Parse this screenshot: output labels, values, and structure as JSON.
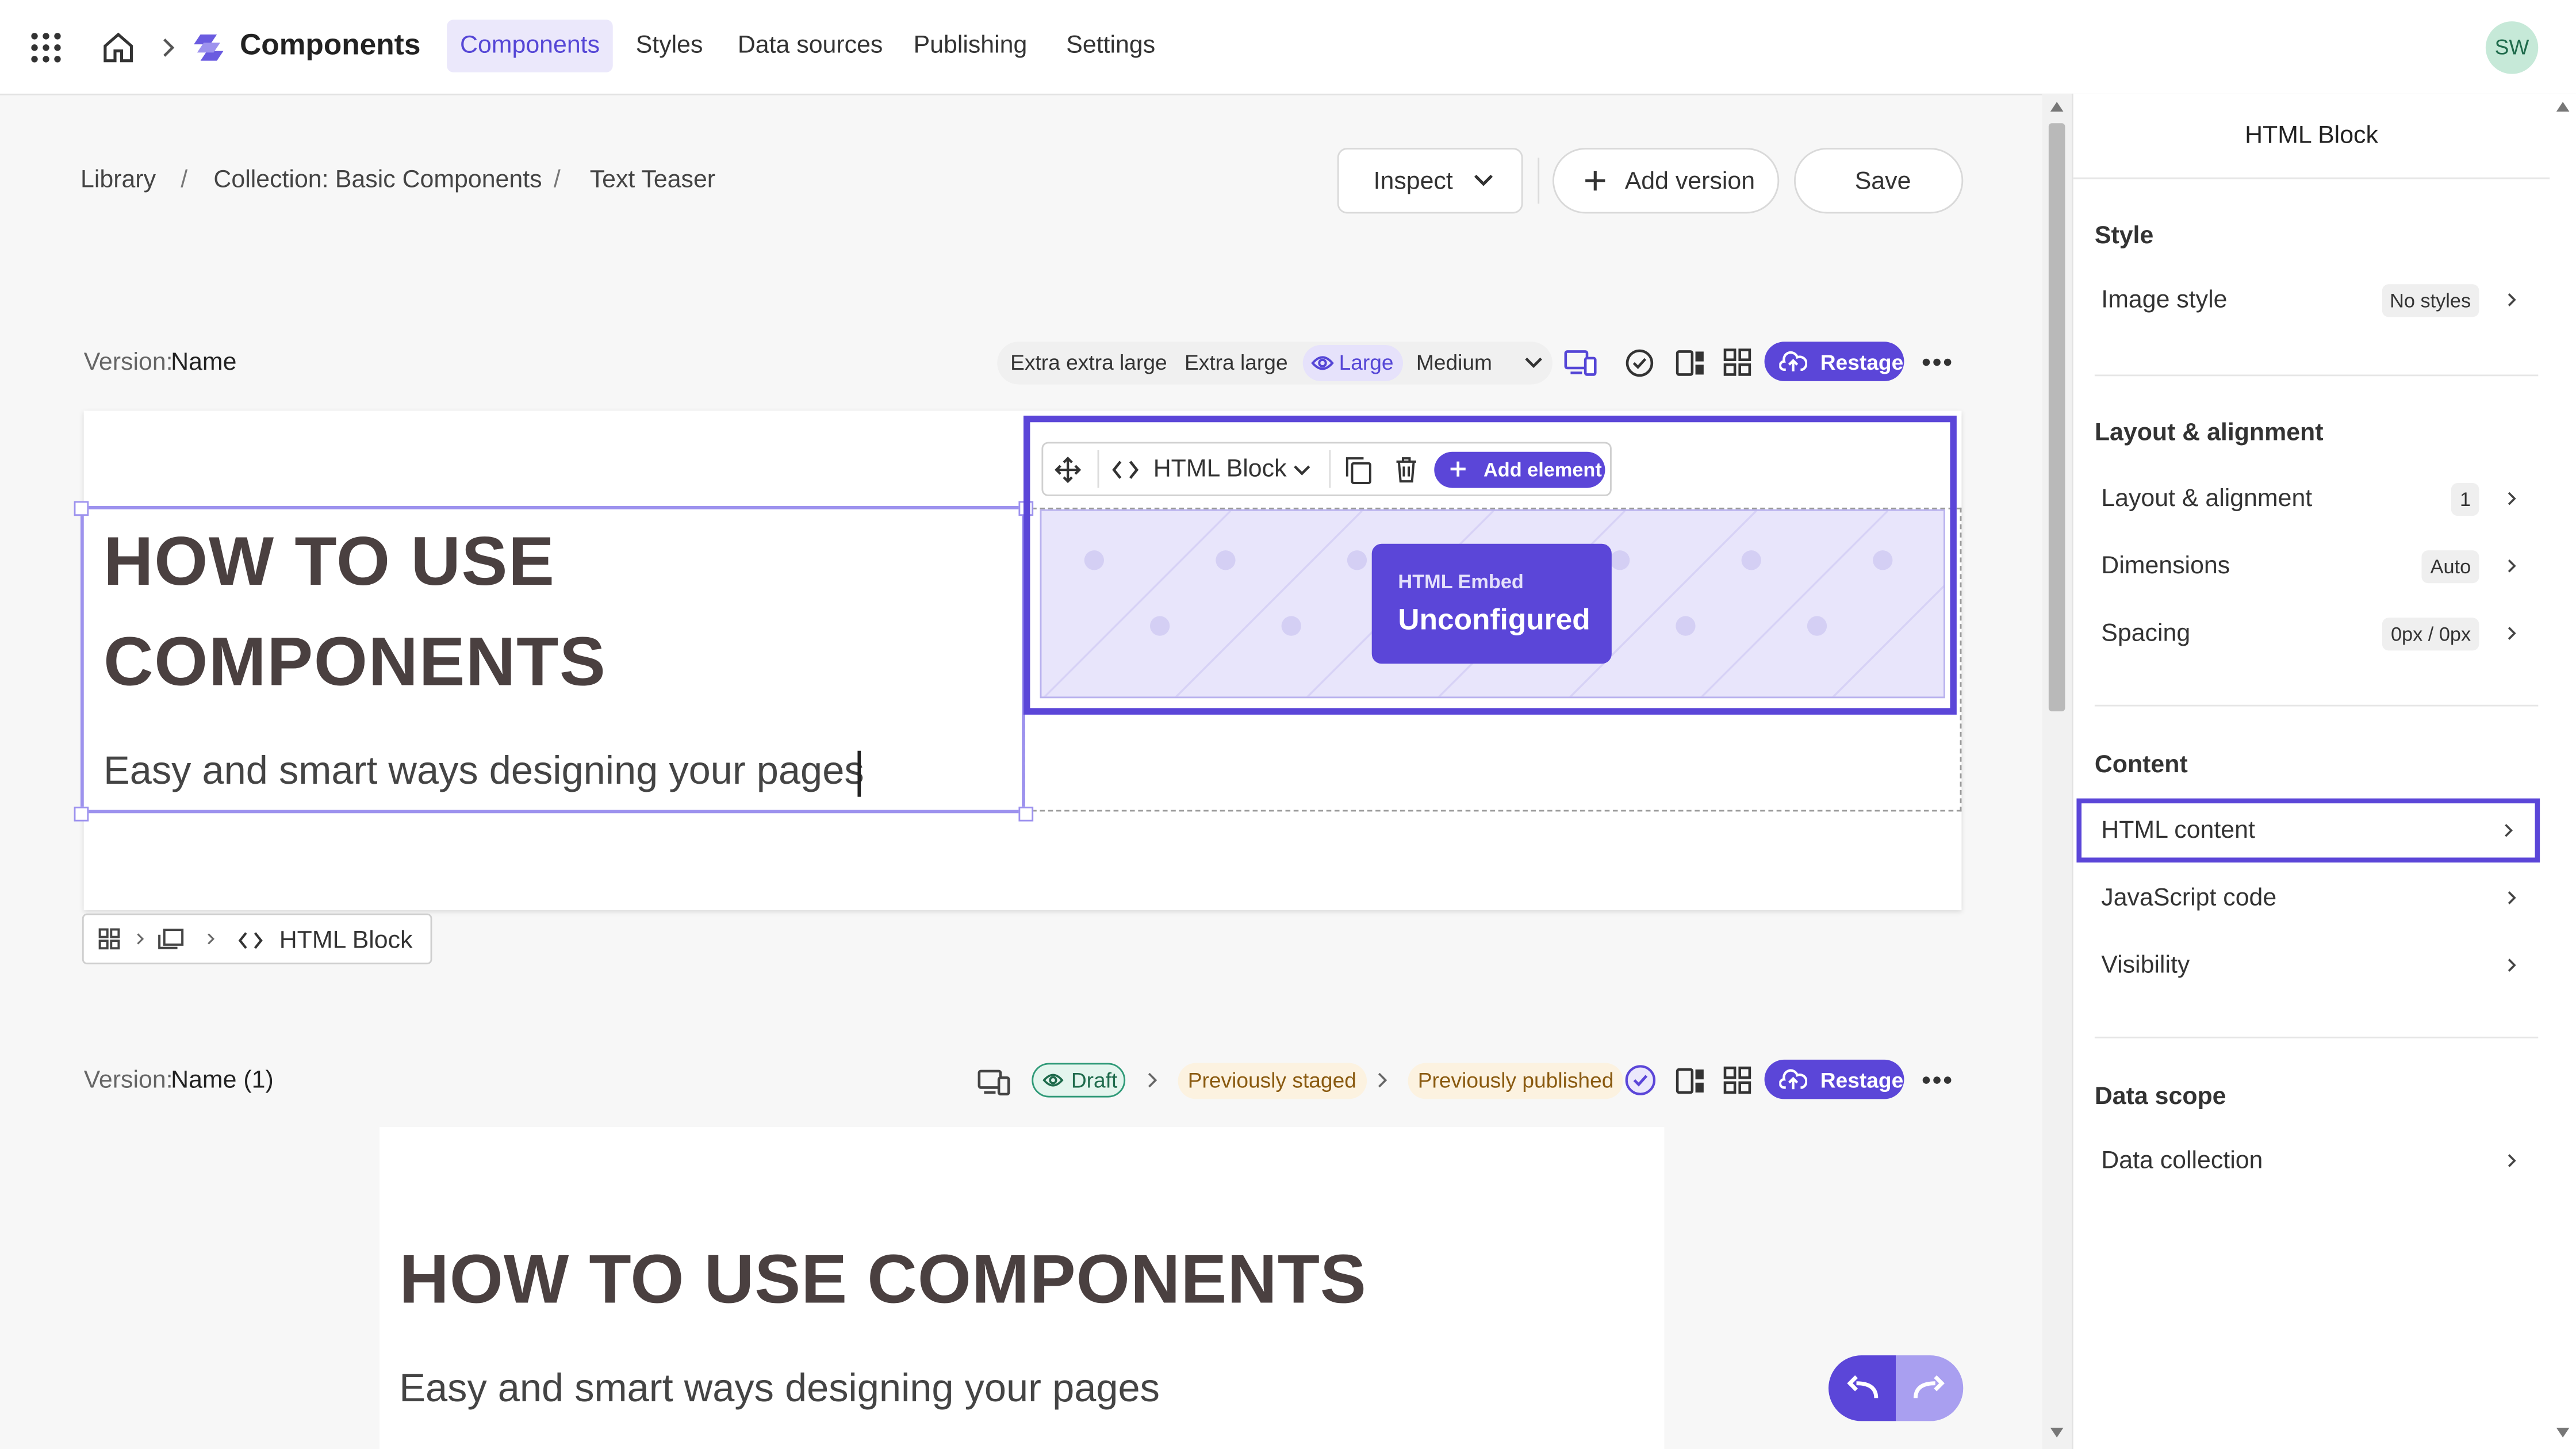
{
  "topbar": {
    "app_title": "Components",
    "nav": [
      "Components",
      "Styles",
      "Data sources",
      "Publishing",
      "Settings"
    ],
    "avatar": "SW"
  },
  "breadcrumb": {
    "library": "Library",
    "collection_prefix": "Collection:",
    "collection": "Basic Components",
    "item": "Text Teaser",
    "sep": "/"
  },
  "actions": {
    "inspect": "Inspect",
    "add_version": "Add version",
    "save": "Save"
  },
  "version1": {
    "label": "Version:",
    "name": "Name",
    "breakpoints": [
      "Extra extra large",
      "Extra large",
      "Large",
      "Medium"
    ],
    "restage": "Restage"
  },
  "preview1": {
    "heading_line1": "HOW TO USE",
    "heading_line2": "COMPONENTS",
    "subtitle": "Easy and smart ways designing your pages",
    "toolbar_block": "HTML Block",
    "add_element": "Add element",
    "embed_label": "HTML Embed",
    "embed_status": "Unconfigured"
  },
  "element_path": {
    "leaf": "HTML Block"
  },
  "version2": {
    "label": "Version:",
    "name": "Name (1)",
    "draft": "Draft",
    "staged": "Previously staged",
    "published": "Previously published",
    "restage": "Restage"
  },
  "preview2": {
    "heading": "HOW TO USE COMPONENTS",
    "subtitle": "Easy and smart ways designing your pages"
  },
  "panel": {
    "title": "HTML Block",
    "style_title": "Style",
    "image_style": "Image style",
    "image_style_value": "No styles",
    "layout_title": "Layout & alignment",
    "layout_row": "Layout & alignment",
    "layout_value": "1",
    "dimensions": "Dimensions",
    "dimensions_value": "Auto",
    "spacing": "Spacing",
    "spacing_value": "0px / 0px",
    "content_title": "Content",
    "html_content": "HTML content",
    "js_code": "JavaScript code",
    "visibility": "Visibility",
    "data_scope_title": "Data scope",
    "data_collection": "Data collection"
  },
  "colors": {
    "accent": "#5b46d8",
    "accent_light": "#ebe8fb",
    "selection": "#5b46d8"
  }
}
